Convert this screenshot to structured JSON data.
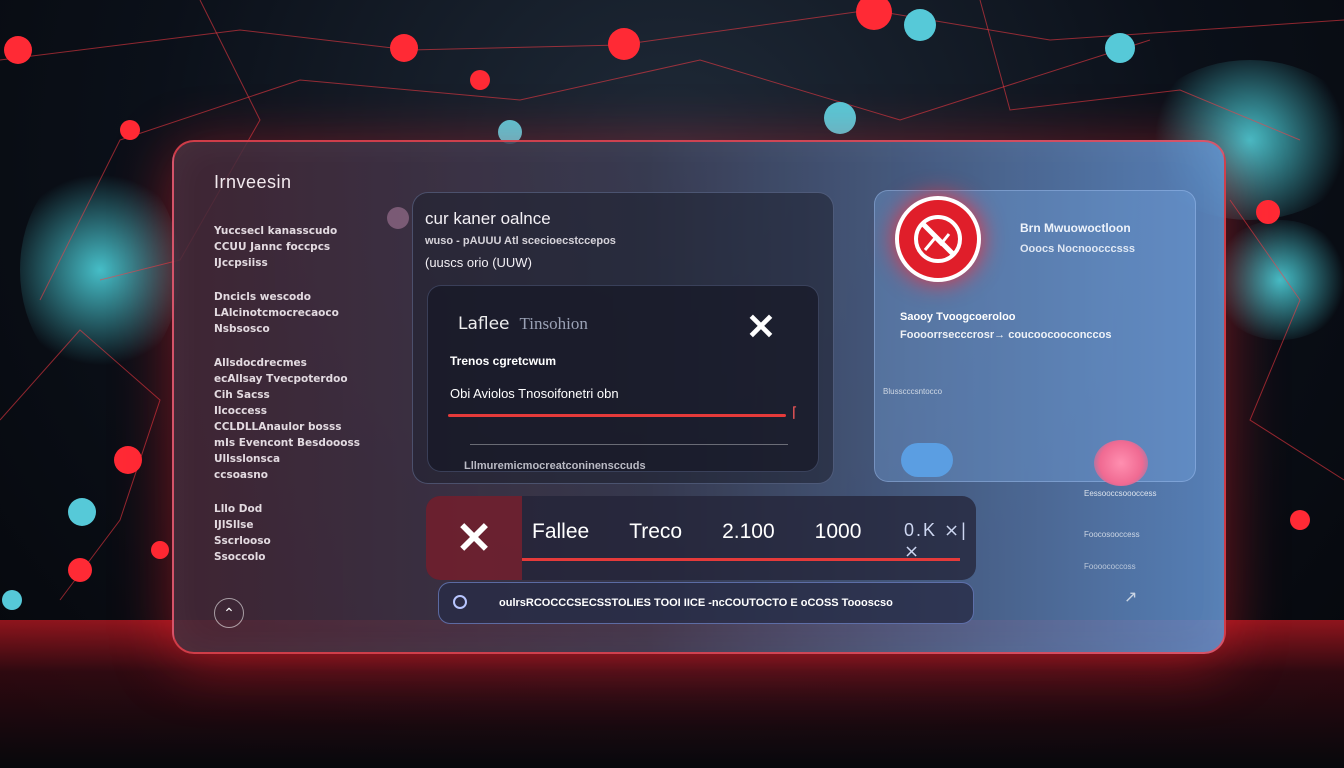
{
  "window": {
    "app_title": "Irnveesin"
  },
  "sidebar": {
    "lines": [
      "Yuccsecl kanasscudo",
      "CCUU Jannc foccpcs",
      "IJccpsiiss",
      "",
      "Dncicls wescodo",
      "LAlcinotcmocrecaoco",
      "Nsbsosco",
      "",
      "Allsdocdrecmes",
      "ecAllsay Tvecpoterdoo",
      "Cih Sacss",
      "Ilcoccess",
      "CCLDLLAnaulor bosss",
      "mIs Evencont Besdoooss",
      "Ullsslonsca",
      "ccsoasno",
      "",
      "Lllo Dod",
      "IJlSllse",
      "Sscrlooso",
      "Ssoccolo"
    ],
    "home_icon": "home-chevron-icon"
  },
  "main_card": {
    "title": "cur kaner oalnce",
    "subtitle": "wuso - pAUUU  Atl  scecioecstccepos",
    "subtitle2": "(uuscs orio (UUW)",
    "inner": {
      "title": "Laflee",
      "title_light": "Tinsohion",
      "close_icon": "close-x-icon",
      "label": "Trenos cgretcwum",
      "field_value": "Obi Aviolos Tnosoifonetri obn",
      "footer": "Lllmuremicmocreatconinensccuds"
    }
  },
  "right_card": {
    "warning_icon": "no-entry-warning-icon",
    "title": "Brn Mwuowoctloon",
    "subtitle": "Ooocs  Nocnoocccsss",
    "line1": "Saooy Tvoogcoeroloo",
    "line2": "Foooorrsecccrosr→ coucoocooconccos",
    "line3": "Blusscccsntocco"
  },
  "side_panel": {
    "text1": "Eessooccsoooccess",
    "text2": "Foocosooccess",
    "text3": "Foooococcoss",
    "icon": "expand-arrows-icon"
  },
  "result_bar": {
    "x_icon": "reject-x-icon",
    "items": [
      "Fallee",
      "Treco",
      "2.100",
      "1000",
      "0.K"
    ],
    "mini": "⨯|⨯"
  },
  "status_bar": {
    "text": "oulrsRCOCCCSECSSTOLIES  TOOI  IICE  -ncCOUTOCTO E  oCOSS  Toooscso"
  },
  "colors": {
    "accent_red": "#e53a3a",
    "glow_red": "#ff1e28",
    "panel_blue": "#5b9ee2",
    "toggle": "#5b9ee2"
  }
}
